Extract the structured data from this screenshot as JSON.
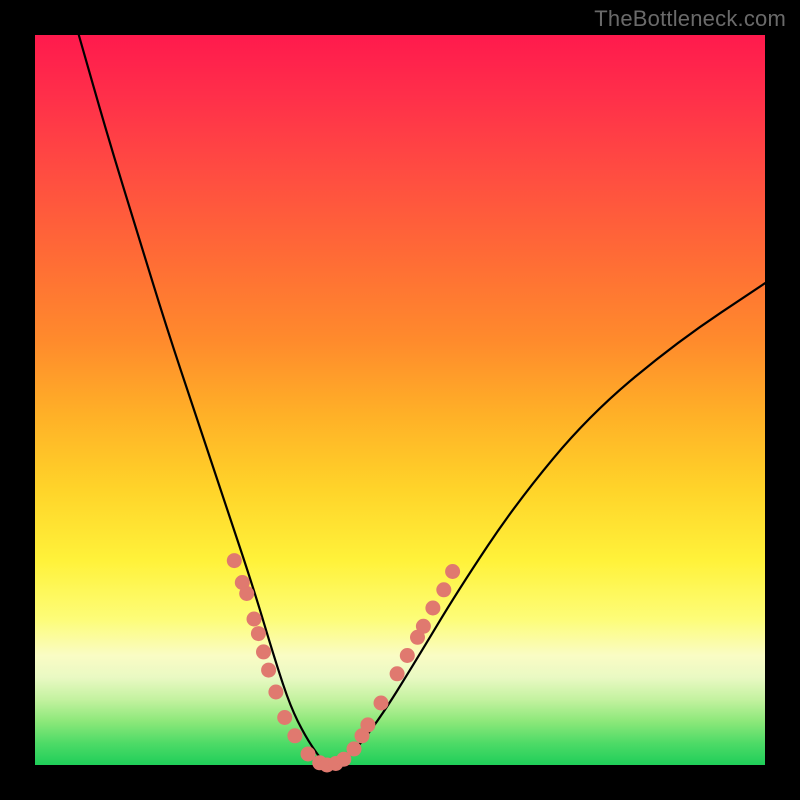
{
  "watermark": "TheBottleneck.com",
  "colors": {
    "frame": "#000000",
    "curve_stroke": "#000000",
    "bead_fill": "#e0796f",
    "gradient_stops": [
      "#ff1a4d",
      "#ff8b2c",
      "#fff23a",
      "#fafcc4",
      "#1fce59"
    ]
  },
  "chart_data": {
    "type": "line",
    "title": "",
    "xlabel": "",
    "ylabel": "",
    "xlim": [
      0,
      100
    ],
    "ylim": [
      0,
      100
    ],
    "grid": false,
    "legend": false,
    "note": "Axes are unlabeled in the image; x/y values are estimated in percent of plot area (0=left/bottom, 100=right/top).",
    "series": [
      {
        "name": "curve",
        "x": [
          6,
          10,
          14,
          18,
          22,
          26,
          30,
          33,
          35,
          37,
          39,
          40,
          43,
          47,
          52,
          58,
          66,
          76,
          88,
          100
        ],
        "y": [
          100,
          86,
          73,
          60,
          48,
          36,
          24,
          14,
          8,
          4,
          1,
          0,
          1,
          6,
          14,
          24,
          36,
          48,
          58,
          66
        ]
      }
    ],
    "beads": {
      "name": "dots-on-curve",
      "x": [
        27.3,
        28.4,
        29.0,
        30.0,
        30.6,
        31.3,
        32.0,
        33.0,
        34.2,
        35.6,
        37.4,
        39.0,
        40.0,
        41.2,
        42.3,
        43.7,
        44.8,
        45.6,
        47.4,
        49.6,
        51.0,
        52.4,
        53.2,
        54.5,
        56.0,
        57.2
      ],
      "y": [
        28.0,
        25.0,
        23.5,
        20.0,
        18.0,
        15.5,
        13.0,
        10.0,
        6.5,
        4.0,
        1.5,
        0.3,
        0.0,
        0.2,
        0.8,
        2.2,
        4.0,
        5.5,
        8.5,
        12.5,
        15.0,
        17.5,
        19.0,
        21.5,
        24.0,
        26.5
      ]
    }
  }
}
